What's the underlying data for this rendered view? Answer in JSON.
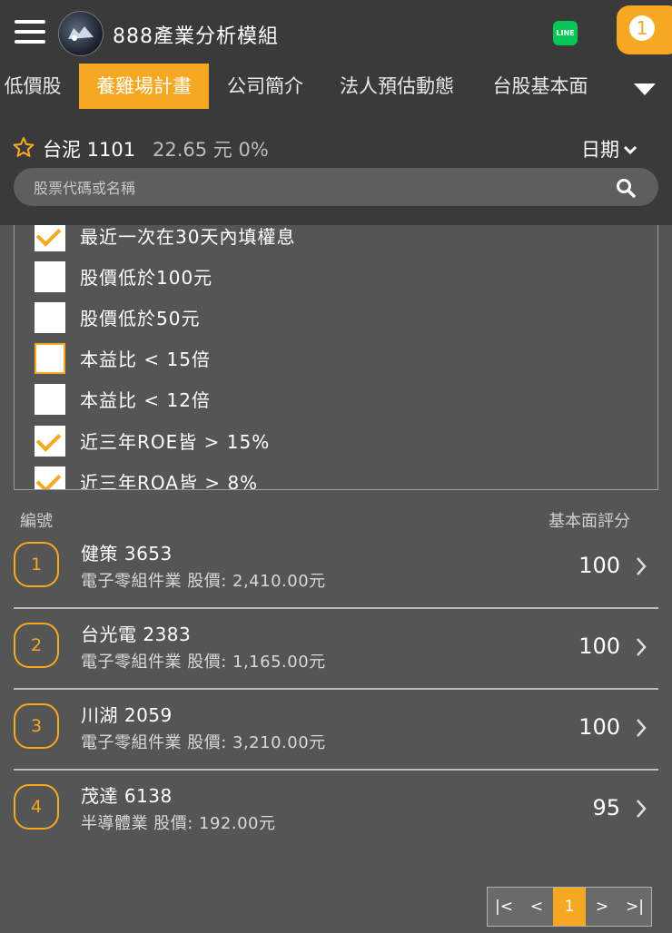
{
  "header": {
    "title": "888產業分析模組",
    "line_label": "LINE",
    "notification_count": "1"
  },
  "tabs": [
    {
      "label": "低價股",
      "active": false
    },
    {
      "label": "養雞場計畫",
      "active": true
    },
    {
      "label": "公司簡介",
      "active": false
    },
    {
      "label": "法人預估動態",
      "active": false
    },
    {
      "label": "台股基本面",
      "active": false
    }
  ],
  "stock": {
    "name_code": "台泥 1101",
    "price_change": "22.65 元  0%",
    "date_label": "日期"
  },
  "search": {
    "placeholder": "股票代碼或名稱"
  },
  "filters": [
    {
      "label": "最近一次在30天內填權息",
      "checked": true
    },
    {
      "label": "股價低於100元",
      "checked": false
    },
    {
      "label": "股價低於50元",
      "checked": false
    },
    {
      "label": "本益比 < 15倍",
      "checked": false
    },
    {
      "label": "本益比 < 12倍",
      "checked": false
    },
    {
      "label": "近三年ROE皆 > 15%",
      "checked": true
    },
    {
      "label": "近三年ROA皆 > 8%",
      "checked": true
    }
  ],
  "list": {
    "col_rank": "編號",
    "col_score": "基本面評分",
    "rows": [
      {
        "rank": "1",
        "name": "健策 3653",
        "detail": "電子零組件業  股價: 2,410.00元",
        "score": "100"
      },
      {
        "rank": "2",
        "name": "台光電 2383",
        "detail": "電子零組件業  股價: 1,165.00元",
        "score": "100"
      },
      {
        "rank": "3",
        "name": "川湖 2059",
        "detail": "電子零組件業  股價: 3,210.00元",
        "score": "100"
      },
      {
        "rank": "4",
        "name": "茂達 6138",
        "detail": "半導體業  股價: 192.00元",
        "score": "95"
      }
    ]
  },
  "pagination": {
    "first": "|<",
    "prev": "<",
    "current": "1",
    "next": ">",
    "last": ">|"
  },
  "colors": {
    "accent": "#f7a823",
    "background": "#555555",
    "header": "#3a3a3a"
  }
}
